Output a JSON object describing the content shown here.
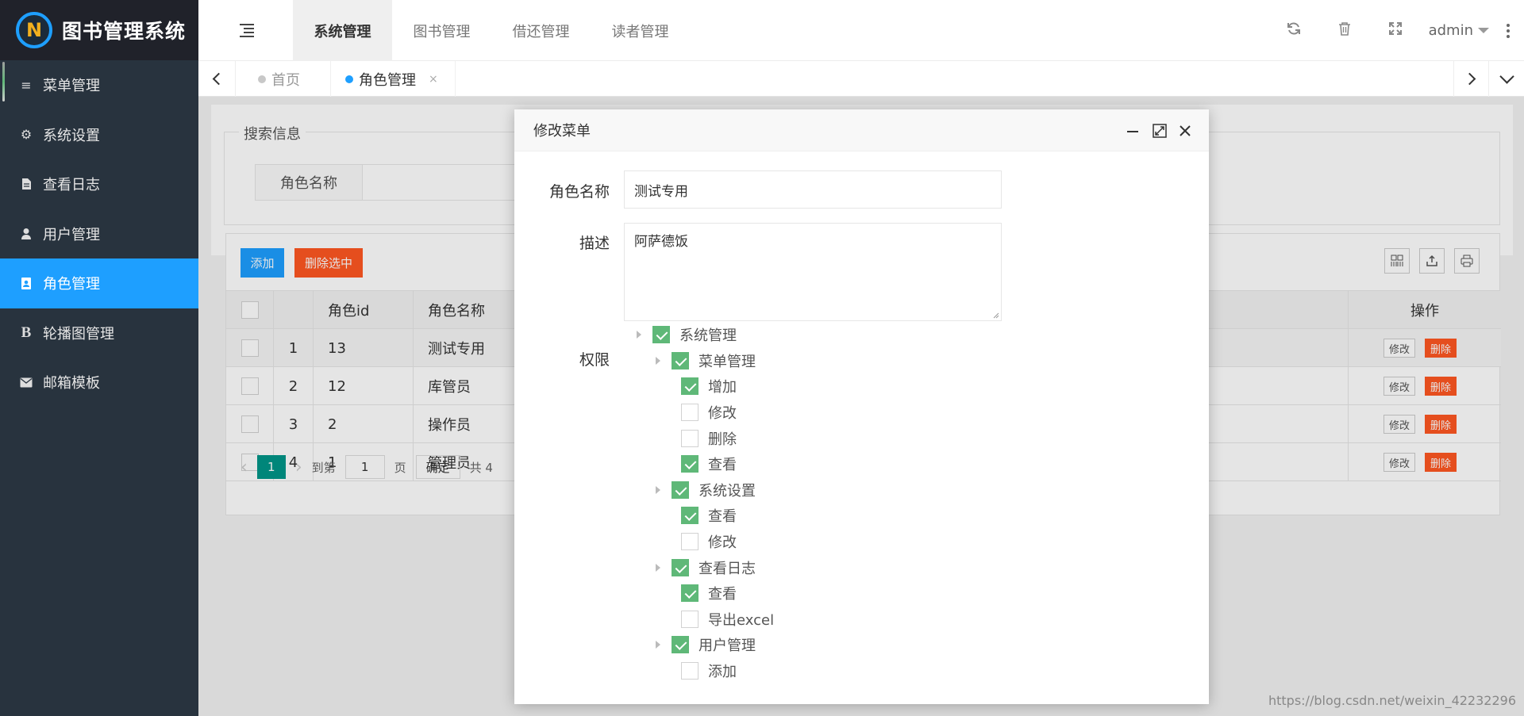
{
  "app": {
    "title": "图书管理系统",
    "logo_letter": "N"
  },
  "sidebar": {
    "items": [
      {
        "label": "菜单管理",
        "icon": "list-icon"
      },
      {
        "label": "系统设置",
        "icon": "gear-icon"
      },
      {
        "label": "查看日志",
        "icon": "document-icon"
      },
      {
        "label": "用户管理",
        "icon": "user-icon"
      },
      {
        "label": "角色管理",
        "icon": "id-card-icon",
        "active": true
      },
      {
        "label": "轮播图管理",
        "icon": "bold-b-icon"
      },
      {
        "label": "邮箱模板",
        "icon": "envelope-icon"
      }
    ]
  },
  "header": {
    "tabs": [
      "系统管理",
      "图书管理",
      "借还管理",
      "读者管理"
    ],
    "active_tab": "系统管理",
    "user": "admin"
  },
  "pagetabs": {
    "home": "首页",
    "current": "角色管理",
    "close": "×"
  },
  "search": {
    "legend": "搜索信息",
    "label": "角色名称"
  },
  "table": {
    "add_label": "添加",
    "delete_selected_label": "删除选中",
    "columns": [
      "角色id",
      "角色名称",
      "操作"
    ],
    "rows": [
      {
        "no": "1",
        "id": "13",
        "name": "测试专用"
      },
      {
        "no": "2",
        "id": "12",
        "name": "库管员"
      },
      {
        "no": "3",
        "id": "2",
        "name": "操作员"
      },
      {
        "no": "4",
        "id": "1",
        "name": "管理员"
      }
    ],
    "edit_label": "修改",
    "delete_label": "删除",
    "pager": {
      "current": "1",
      "goto": "到第",
      "page_input": "1",
      "page_unit": "页",
      "confirm": "确定",
      "total": "共 4"
    }
  },
  "modal": {
    "title": "修改菜单",
    "name_label": "角色名称",
    "name_value": "测试专用",
    "desc_label": "描述",
    "desc_value": "阿萨德饭",
    "perm_label": "权限",
    "tree": [
      {
        "label": "系统管理",
        "level": 0,
        "checked": true,
        "expandable": true
      },
      {
        "label": "菜单管理",
        "level": 1,
        "checked": true,
        "expandable": true
      },
      {
        "label": "增加",
        "level": 2,
        "checked": true
      },
      {
        "label": "修改",
        "level": 2,
        "checked": false
      },
      {
        "label": "删除",
        "level": 2,
        "checked": false
      },
      {
        "label": "查看",
        "level": 2,
        "checked": true
      },
      {
        "label": "系统设置",
        "level": 1,
        "checked": true,
        "expandable": true
      },
      {
        "label": "查看",
        "level": 2,
        "checked": true
      },
      {
        "label": "修改",
        "level": 2,
        "checked": false
      },
      {
        "label": "查看日志",
        "level": 1,
        "checked": true,
        "expandable": true
      },
      {
        "label": "查看",
        "level": 2,
        "checked": true
      },
      {
        "label": "导出excel",
        "level": 2,
        "checked": false
      },
      {
        "label": "用户管理",
        "level": 1,
        "checked": true,
        "expandable": true
      },
      {
        "label": "添加",
        "level": 2,
        "checked": false
      }
    ]
  },
  "watermark": "https://blog.csdn.net/weixin_42232296",
  "colors": {
    "sidebar": "#28333e",
    "accent": "#1e9fff",
    "danger": "#ff5722",
    "check": "#5fb878",
    "pager": "#009688"
  }
}
